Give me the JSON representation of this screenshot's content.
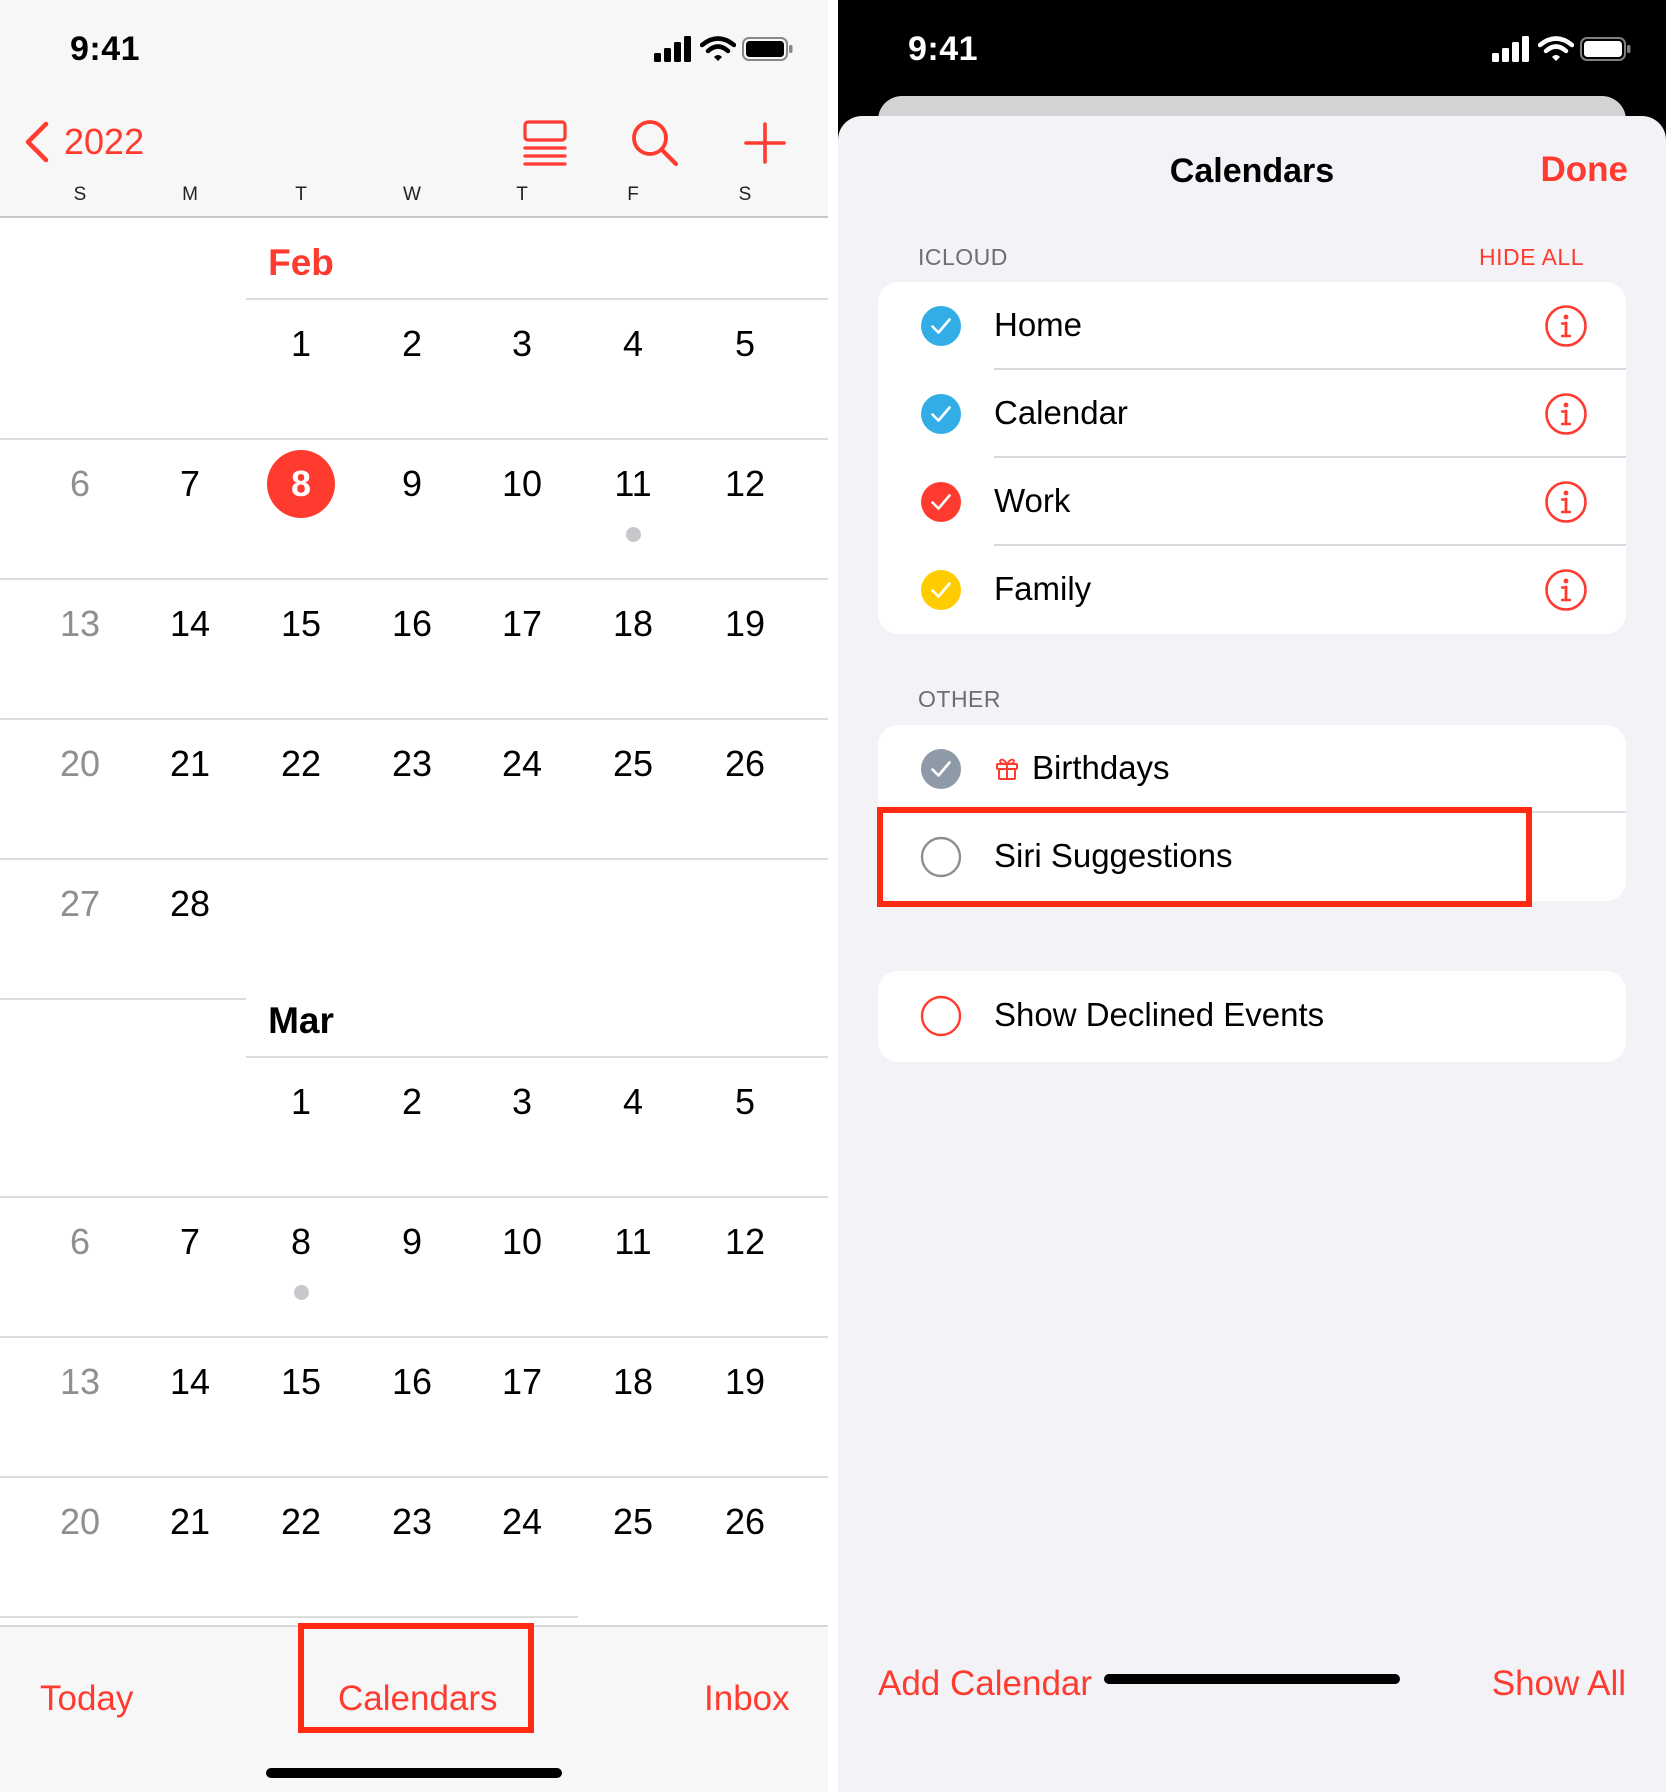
{
  "left": {
    "status_time": "9:41",
    "nav": {
      "year": "2022",
      "icons": [
        "list-view-icon",
        "search-icon",
        "plus-icon"
      ]
    },
    "weekdays": [
      "S",
      "M",
      "T",
      "W",
      "T",
      "F",
      "S"
    ],
    "months": [
      {
        "name": "Feb",
        "current": true,
        "weeks": [
          [
            "",
            "",
            "1",
            "2",
            "3",
            "4",
            "5"
          ],
          [
            "6",
            "7",
            "8",
            "9",
            "10",
            "11",
            "12"
          ],
          [
            "13",
            "14",
            "15",
            "16",
            "17",
            "18",
            "19"
          ],
          [
            "20",
            "21",
            "22",
            "23",
            "24",
            "25",
            "26"
          ],
          [
            "27",
            "28",
            "",
            "",
            "",
            "",
            ""
          ]
        ],
        "today": "8",
        "events": [
          "11"
        ]
      },
      {
        "name": "Mar",
        "current": false,
        "weeks": [
          [
            "",
            "",
            "1",
            "2",
            "3",
            "4",
            "5"
          ],
          [
            "6",
            "7",
            "8",
            "9",
            "10",
            "11",
            "12"
          ],
          [
            "13",
            "14",
            "15",
            "16",
            "17",
            "18",
            "19"
          ],
          [
            "20",
            "21",
            "22",
            "23",
            "24",
            "25",
            "26"
          ]
        ],
        "today": null,
        "events": [
          "8"
        ]
      }
    ],
    "tabs": {
      "today": "Today",
      "calendars": "Calendars",
      "inbox": "Inbox"
    },
    "highlighted_tab": "calendars"
  },
  "right": {
    "status_time": "9:41",
    "sheet_title": "Calendars",
    "done": "Done",
    "icloud": {
      "header": "ICLOUD",
      "hide_all": "HIDE ALL",
      "items": [
        {
          "label": "Home",
          "checked": true,
          "color": "#32ade6"
        },
        {
          "label": "Calendar",
          "checked": true,
          "color": "#32ade6"
        },
        {
          "label": "Work",
          "checked": true,
          "color": "#ff3b30"
        },
        {
          "label": "Family",
          "checked": true,
          "color": "#ffcc00"
        }
      ]
    },
    "other": {
      "header": "OTHER",
      "items": [
        {
          "label": "Birthdays",
          "checked": true,
          "color": "#8e9aa7",
          "icon": "gift-icon"
        },
        {
          "label": "Siri Suggestions",
          "checked": false,
          "color": "#8e8e93"
        }
      ],
      "highlighted_item": "Siri Suggestions"
    },
    "declined": {
      "label": "Show Declined Events",
      "checked": false,
      "color": "#ff3b30"
    },
    "add_calendar": "Add Calendar",
    "show_all": "Show All"
  },
  "colors": {
    "accent": "#ff3b30",
    "highlight": "#ff2a12"
  }
}
